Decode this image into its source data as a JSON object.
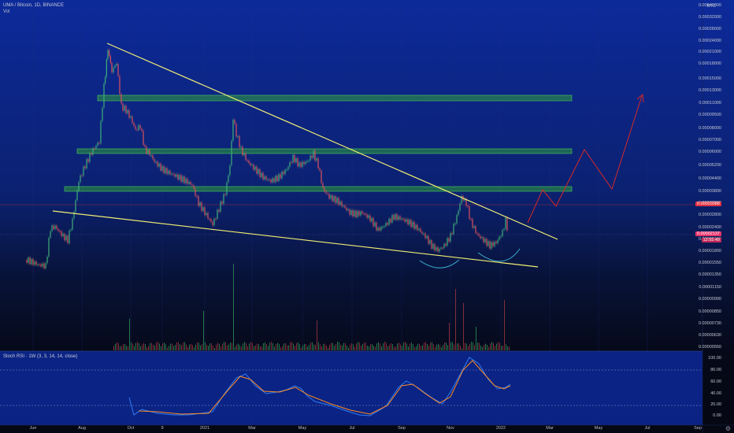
{
  "header": {
    "symbol": "UMA / Bitcoin, 1D, BINANCE",
    "vol_label": "Vol"
  },
  "currency": "BTC",
  "price_labels": [
    "0.00040000",
    "0.00032000",
    "0.00028000",
    "0.00024000",
    "0.00021000",
    "0.00018000",
    "0.00015000",
    "0.00013000",
    "0.00011000",
    "0.00009500",
    "0.00008000",
    "0.00007000",
    "0.00006000",
    "0.00005200",
    "0.00004400",
    "0.00003800",
    "0.00003200",
    "0.00002800",
    "0.00002400",
    "0.00002100",
    "0.00001800",
    "0.00001550",
    "0.00001350",
    "0.00001150",
    "0.00000990",
    "0.00000850",
    "0.00000730",
    "0.00000630",
    "0.00000550"
  ],
  "price_tags": {
    "level_line": "0.00003088",
    "current_price": "0.00002137",
    "countdown": "12:55:49"
  },
  "x_labels": [
    "Jun",
    "Aug",
    "Oct",
    "9",
    "2021",
    "Mar",
    "May",
    "Jul",
    "Sep",
    "Nov",
    "2022",
    "Mar",
    "May",
    "Jul",
    "Sep"
  ],
  "stoch": {
    "legend": "Stoch RSI · 1W (3, 3, 14, 14, close)",
    "labels": [
      "100.00",
      "80.00",
      "60.00",
      "40.00",
      "20.00",
      "0.00"
    ]
  },
  "colors": {
    "trendline": "#f2ee73",
    "zones": "#2f9e3e",
    "projection": "#d62828",
    "level_line": "#c0303a",
    "rsi_k": "#2f7cf6",
    "rsi_d": "#ff8a1f"
  }
}
